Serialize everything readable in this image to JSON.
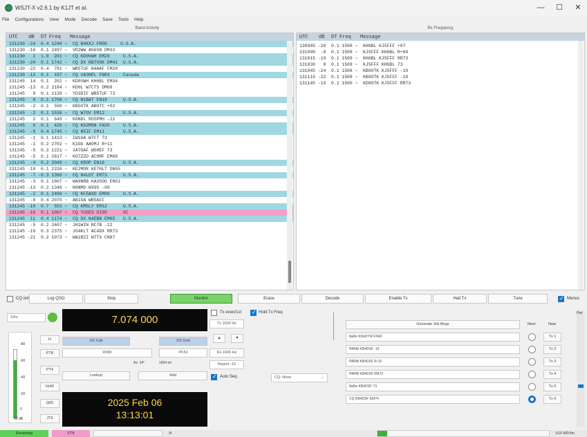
{
  "window": {
    "title": "WSJT-X   v2.6.1   by K1JT et al.",
    "min": "—",
    "max": "☐",
    "close": "✕"
  },
  "menu": [
    "File",
    "Configurations",
    "View",
    "Mode",
    "Decode",
    "Save",
    "Tools",
    "Help"
  ],
  "band_activity": {
    "title": "Band Activity",
    "header": {
      "utc": "UTC",
      "db": "dB",
      "dt": "DT",
      "freq": "Freq",
      "message": "Message"
    },
    "rows": [
      {
        "text": "131230 -24  0.4 1240 ~  CQ N4KXJ FM06     U.S.A.",
        "type": "cq"
      },
      {
        "text": "131230 -16  0.1 2497 ~  VR2WW AG6SN DM33",
        "type": "plain"
      },
      {
        "text": "131230   2  1.0  201 ~  CQ KD0VWH EM29     U.S.A.",
        "type": "cq"
      },
      {
        "text": "131230 -24  0.1 1742 ~  CQ DX KB7VGK DM41  U.S.A.",
        "type": "cq"
      },
      {
        "text": "131230 -22  0.4  781 ~  WB5TUF N4AAF FM20",
        "type": "plain"
      },
      {
        "text": "131230 -12  0.1  197 ~  CQ VA3NPL FN03     Canada",
        "type": "cq"
      },
      {
        "text": "131245  14  0.1  202 ~  KD0VWH KH6BL EM34",
        "type": "plain"
      },
      {
        "text": "131245 -13  0.2 2184 ~  KD0L W7CTS DM09",
        "type": "plain"
      },
      {
        "text": "131245   9  0.1 1139 ~  YD3DIF WB5TUF 73",
        "type": "plain"
      },
      {
        "text": "131245   8  0.1 1708 ~  CQ N1BAT FN19      U.S.A.",
        "type": "cq"
      },
      {
        "text": "131245  -2  0.1  550 ~  KB5OTK AB0TC +02",
        "type": "plain"
      },
      {
        "text": "131245  -2  0.1 1536 ~  CQ W7OV EM12       U.S.A.",
        "type": "cq"
      },
      {
        "text": "131245   2  0.1  649 ~  K0NDL RG5PMH -22",
        "type": "plain"
      },
      {
        "text": "131245   0  0.1  420 ~  CQ KD2MON FN20     U.S.A.",
        "type": "cq"
      },
      {
        "text": "131245  -9  0.4 1745 ~  CQ N5IF EM11       U.S.A.",
        "type": "cq"
      },
      {
        "text": "131245  -1  0.1 1413 ~  IW1GA W7CT 73",
        "type": "plain"
      },
      {
        "text": "131245  -1  0.2 2702 ~  K1GG AA0MJ R+11",
        "type": "plain"
      },
      {
        "text": "131245  -5  0.3 1221 ~  JA7GAF W5HEF 73",
        "type": "plain"
      },
      {
        "text": "131245  -5  0.1 2617 ~  KO7ZZO AC9MF EM69",
        "type": "plain"
      },
      {
        "text": "131245  -4  0.2 2049 ~  CQ KR0P EN16       U.S.A.",
        "type": "cq"
      },
      {
        "text": "131245 -10  0.1 2316 ~  KE2MDR KE7HLT DN55",
        "type": "plain"
      },
      {
        "text": "131245  -7 -0.3 1360 ~  CQ N4LDT EM73      U.S.A.",
        "type": "cq"
      },
      {
        "text": "131245  -3  0.1 1607 ~  WA9NRB KA3SOG EN51",
        "type": "plain"
      },
      {
        "text": "131245 -13  0.2 1348 ~  N9NMD NX9S -09",
        "type": "plain"
      },
      {
        "text": "131245  -2  0.1 2496 ~  CQ KF5AXD EM90     U.S.A.",
        "type": "cq"
      },
      {
        "text": "131245  -8  0.4 2070 ~  AB1SA WB5AFF",
        "type": "plain"
      },
      {
        "text": "131245 -10  0.7  553 ~  CQ KM5LY EM12      U.S.A.",
        "type": "cq"
      },
      {
        "text": "131245 -16  0.1 1097 ~  CQ YU5ES OI95      OC",
        "type": "mine"
      },
      {
        "text": "131245  11  0.4 1174 ~  CQ DX N4EBN EM65   U.S.A.",
        "type": "cq"
      },
      {
        "text": "131245  -5  0.2 2407 ~  JH1WIN NC7B -22",
        "type": "plain"
      },
      {
        "text": "131245 -10  0.3 2375 ~  JO4KLT AC4DX RR73",
        "type": "plain"
      },
      {
        "text": "131245 -21  0.2 1073 ~  WA1RZI W7TX CN87",
        "type": "plain"
      }
    ]
  },
  "rx_frequency": {
    "title": "Rx Frequency",
    "header": {
      "utc": "UTC",
      "db": "dB",
      "dt": "DT",
      "freq": "Freq",
      "message": "Message"
    },
    "rows": [
      "130945 -20  0.1 1508 ~  KH6BL KJ5FFF +07",
      "131000  -9  0.1 1509 ~  KJ5FFF KH6BL R+04",
      "131015 -19  0.1 1509 ~  KH6BL KJ5FFF RR73",
      "131030   8  0.1 1509 ~  KJ5FFF KH6BL 73",
      "131045 -24  0.1 1508 ~  KB0OTK KJ5FFF -10",
      "131115 -22  0.1 1508 ~  KB0OTK KJ5FFF -10",
      "131145 -19  0.1 1500 ~  KD0OTK KJ5FFF RR73"
    ]
  },
  "buttons": {
    "cq_only": "CQ only",
    "log_qso": "Log QSO",
    "stop": "Stop",
    "monitor": "Monitor",
    "erase": "Erase",
    "decode": "Decode",
    "enable_tx": "Enable Tx",
    "halt_tx": "Halt Tx",
    "tune": "Tune",
    "menus": "Menus"
  },
  "controls": {
    "band": "10m",
    "frequency": "7.074 000",
    "tx_even": "Tx even/1st",
    "hold_tx_freq": "Hold Tx Freq",
    "tx_hz": "Tx 1600 Hz",
    "rx_hz": "Rx 1600 Hz",
    "report": "Report -15",
    "auto_seq": "Auto Seq",
    "cq_select": "CQ: None",
    "dx_call_label": "DX Call",
    "dx_grid_label": "DX Grid",
    "dx_call": "RM9I",
    "dx_grid": "PK52",
    "az": "Az: 14°",
    "dist": "1654 mi",
    "lookup": "Lookup",
    "add": "Add",
    "date": "2025 Feb 06",
    "time": "13:13:01",
    "db_label": "60 dB",
    "side_buttons": [
      "H",
      "PTB",
      "PT4",
      "HoW",
      "Q65",
      "JT9"
    ],
    "generate": "Generate Std Msgs",
    "next": "Next",
    "now": "Now"
  },
  "tx_messages": [
    {
      "text": "8a6lo K8oKYW FN40",
      "label": "Tx 1"
    },
    {
      "text": "PARM KB4DSF -15",
      "label": "Tx 2"
    },
    {
      "text": "PARM KB4DSF R-15",
      "label": "Tx 3"
    },
    {
      "text": "PARM KB4DSF RR73",
      "label": "Tx 4"
    },
    {
      "text": "8a6lo KB4DSF 73",
      "label": "Tx 5"
    },
    {
      "text": "CQ KB4DSF EM74",
      "label": "Tx 6"
    }
  ],
  "statusbar": {
    "receiving": "Receiving",
    "mode": "FT8",
    "seq": "/4",
    "right": "1/15   WD:6m"
  },
  "scale": [
    "-80",
    "-60",
    "-40",
    "-20",
    "0"
  ],
  "colors": {
    "cq_row": "#9fd7e3",
    "my_call_row": "#f2a0c7",
    "monitor_green": "#7ad36a",
    "display_bg": "#0a0a0a",
    "display_text": "#ffd54a"
  }
}
